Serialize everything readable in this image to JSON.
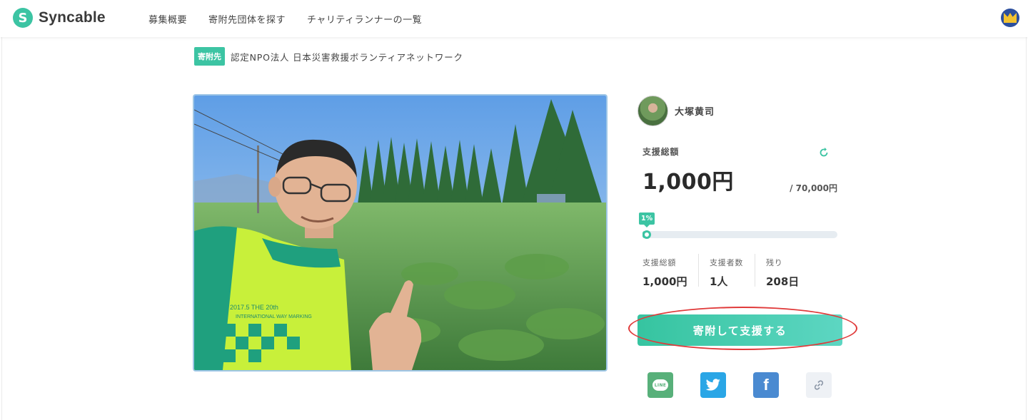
{
  "header": {
    "logo_text": "Syncable",
    "logo_mark": "S",
    "nav": [
      {
        "label": "募集概要"
      },
      {
        "label": "寄附先団体を探す"
      },
      {
        "label": "チャリティランナーの一覧"
      }
    ],
    "user_avatar_icon": "user-avatar-icon"
  },
  "recipient": {
    "tag": "寄附先",
    "name": "認定NPO法人 日本災害救援ボランティアネットワーク"
  },
  "photo": {
    "shirt_text_1": "2017.5 THE 20th",
    "shirt_text_2": "INTERNATIONAL WAY MARKING"
  },
  "runner": {
    "name": "大塚黄司"
  },
  "funding": {
    "total_label": "支援総額",
    "total_value": "1,000円",
    "goal": "/ 70,000円",
    "percent_label": "1%",
    "progress_fraction": 0.014
  },
  "stats": [
    {
      "label": "支援総額",
      "value": "1,000円"
    },
    {
      "label": "支援者数",
      "value": "1人"
    },
    {
      "label": "残り",
      "value": "208日"
    }
  ],
  "donate_button": "寄附して支援する",
  "share": {
    "line_text": "LINE",
    "facebook_text": "f"
  },
  "colors": {
    "accent": "#3cc4a3",
    "highlight": "#e03a3a",
    "twitter": "#2aa6e6",
    "facebook": "#4a8ad1",
    "line": "#58b07a"
  }
}
